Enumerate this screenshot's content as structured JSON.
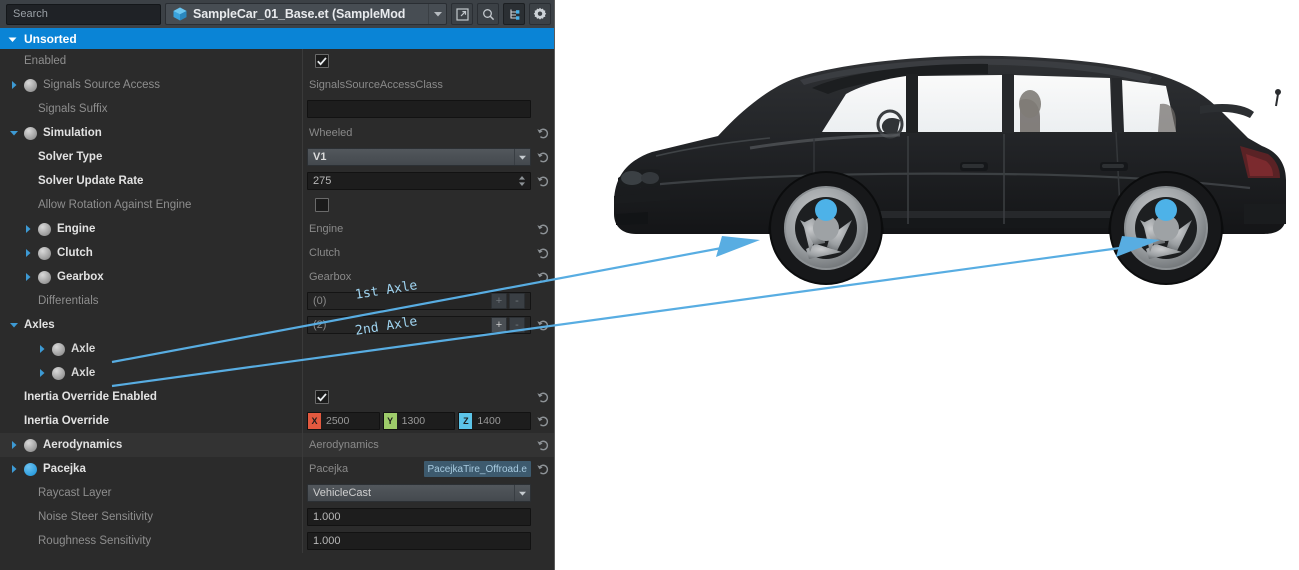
{
  "toolbar": {
    "search_placeholder": "Search",
    "asset_name": "SampleCar_01_Base.et (SampleMod",
    "asset_icon": "cube-icon",
    "dropdown_icon": "chevron-down-icon",
    "buttons": [
      {
        "name": "open-external-button",
        "icon": "external-link-icon",
        "active": false
      },
      {
        "name": "search-button",
        "icon": "magnifier-icon",
        "active": false
      },
      {
        "name": "hierarchy-button",
        "icon": "hierarchy-tree-icon",
        "active": true
      },
      {
        "name": "settings-button",
        "icon": "gear-icon",
        "active": false
      }
    ]
  },
  "section": {
    "title": "Unsorted",
    "expanded": true,
    "caret_icon": "chevron-down-icon",
    "accent_color": "#0a84d6"
  },
  "colors": {
    "accent": "#0a84d6",
    "axis_x": "#e2593f",
    "axis_y": "#9ecc6a",
    "axis_z": "#5cc4e8",
    "annotation": "#5aaee0",
    "panel_bg": "#2b2b2b"
  },
  "properties": [
    {
      "label": "Enabled",
      "style": "dim",
      "indent": 0,
      "widget": "checkbox",
      "checked": true,
      "revert": false
    },
    {
      "label": "Signals Source Access",
      "style": "dim",
      "indent": 0,
      "expander": "right",
      "sphere": "gray",
      "widget": "text",
      "value": "SignalsSourceAccessClass",
      "revert": false
    },
    {
      "label": "Signals Suffix",
      "style": "dim",
      "indent": 1,
      "widget": "input",
      "value": "",
      "revert": false
    },
    {
      "label": "Simulation",
      "style": "bold",
      "indent": 0,
      "expander": "down",
      "sphere": "gray",
      "widget": "text",
      "value": "Wheeled",
      "revert": true
    },
    {
      "label": "Solver Type",
      "style": "bold",
      "indent": 1,
      "widget": "dropdown",
      "value": "V1",
      "revert": true
    },
    {
      "label": "Solver Update Rate",
      "style": "bold",
      "indent": 1,
      "widget": "spinner",
      "value": "275",
      "revert": true
    },
    {
      "label": "Allow Rotation Against Engine",
      "style": "dim",
      "indent": 1,
      "widget": "checkbox",
      "checked": false,
      "revert": false
    },
    {
      "label": "Engine",
      "style": "bold",
      "indent": 1,
      "expander": "right",
      "sphere": "gray",
      "widget": "text",
      "value": "Engine",
      "revert": true
    },
    {
      "label": "Clutch",
      "style": "bold",
      "indent": 1,
      "expander": "right",
      "sphere": "gray",
      "widget": "text",
      "value": "Clutch",
      "revert": true
    },
    {
      "label": "Gearbox",
      "style": "bold",
      "indent": 1,
      "expander": "right",
      "sphere": "gray",
      "widget": "text",
      "value": "Gearbox",
      "revert": true
    },
    {
      "label": "Differentials",
      "style": "dim",
      "indent": 1,
      "widget": "array",
      "count": "(0)",
      "add": "+",
      "remove": "-",
      "revert": false
    },
    {
      "label": "Axles",
      "style": "bold",
      "indent": 0,
      "expander": "down",
      "widget": "array",
      "count": "(2)",
      "add": "+",
      "remove": "-",
      "revert": true
    },
    {
      "label": "Axle",
      "style": "semibold",
      "indent": 2,
      "expander": "right",
      "sphere": "gray",
      "widget": "none",
      "revert": false
    },
    {
      "label": "Axle",
      "style": "semibold",
      "indent": 2,
      "expander": "right",
      "sphere": "gray",
      "widget": "none",
      "revert": false
    },
    {
      "label": "Inertia Override Enabled",
      "style": "bold",
      "indent": 0,
      "widget": "checkbox",
      "checked": true,
      "revert": true
    },
    {
      "label": "Inertia Override",
      "style": "bold",
      "indent": 0,
      "widget": "vector3",
      "x": "2500",
      "y": "1300",
      "z": "1400",
      "revert": true
    },
    {
      "label": "Aerodynamics",
      "style": "bold",
      "indent": 0,
      "expander": "right",
      "sphere": "gray",
      "widget": "text",
      "value": "Aerodynamics",
      "revert": true,
      "alt": true
    },
    {
      "label": "Pacejka",
      "style": "bold",
      "indent": 0,
      "expander": "right",
      "sphere": "blue",
      "widget": "ref",
      "value": "Pacejka",
      "ref": "PacejkaTire_Offroad.e",
      "revert": true
    },
    {
      "label": "Raycast Layer",
      "style": "dim",
      "indent": 1,
      "widget": "dropdown-plain",
      "value": "VehicleCast",
      "revert": false
    },
    {
      "label": "Noise Steer Sensitivity",
      "style": "dim",
      "indent": 1,
      "widget": "input",
      "value": "1.000",
      "revert": false
    },
    {
      "label": "Roughness Sensitivity",
      "style": "dim",
      "indent": 1,
      "widget": "input",
      "value": "1.000",
      "revert": false
    }
  ],
  "annotations": [
    {
      "id": "first-axle",
      "text": "1st Axle"
    },
    {
      "id": "second-axle",
      "text": "2nd Axle"
    }
  ],
  "viewport": {
    "subject": "car-side-view",
    "wheel_markers": 2,
    "marker_color": "#5cb8e8"
  }
}
